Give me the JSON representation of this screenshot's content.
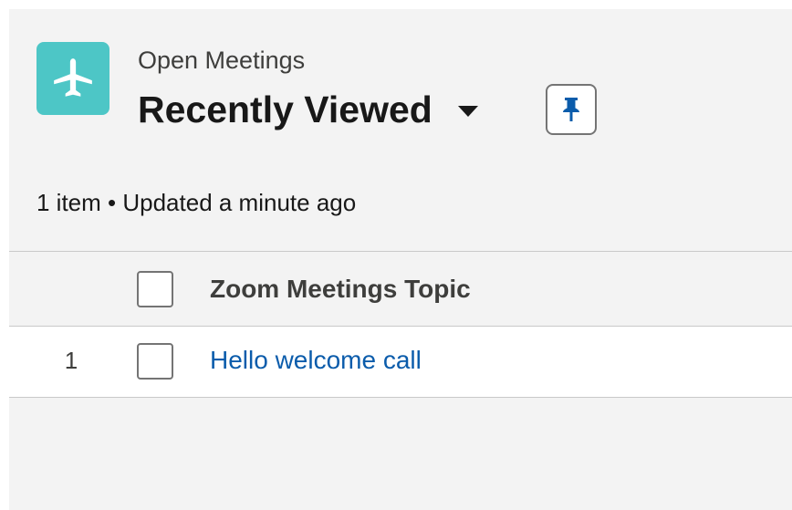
{
  "header": {
    "object_name": "Open Meetings",
    "list_view_title": "Recently Viewed",
    "app_icon": "airplane-icon",
    "pin_icon": "pin-icon",
    "caret_icon": "caret-down-icon"
  },
  "status": {
    "text": "1 item • Updated a minute ago"
  },
  "table": {
    "columns": [
      "Zoom Meetings Topic"
    ],
    "rows": [
      {
        "number": "1",
        "topic": "Hello welcome call"
      }
    ]
  },
  "colors": {
    "icon_background": "#4dc6c6",
    "link": "#0b5cab",
    "page_background": "#f3f3f3"
  }
}
